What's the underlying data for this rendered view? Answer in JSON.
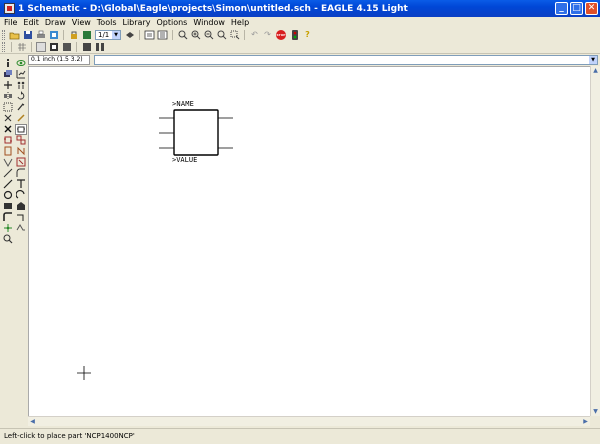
{
  "window": {
    "title": "1 Schematic - D:\\Global\\Eagle\\projects\\Simon\\untitled.sch - EAGLE 4.15 Light",
    "minimize": "_",
    "maximize": "□",
    "close": "✕"
  },
  "menu": {
    "file": "File",
    "edit": "Edit",
    "draw": "Draw",
    "view": "View",
    "tools": "Tools",
    "library": "Library",
    "options": "Options",
    "window": "Window",
    "help": "Help"
  },
  "toolbar": {
    "sheet_select": "1/1",
    "stop_label": "STOP",
    "help_label": "?"
  },
  "command": {
    "grid_readout": "0.1 inch (1.5 3.2)",
    "command_line_value": ""
  },
  "palette": {
    "icons": [
      "info-icon",
      "show-icon",
      "display-icon",
      "mark-icon",
      "move-icon",
      "copy-icon",
      "mirror-icon",
      "rotate-icon",
      "group-icon",
      "change-icon",
      "cut-icon",
      "paste-icon",
      "delete-icon",
      "add-icon",
      "pinswap-icon",
      "gateswap-icon",
      "replace-icon",
      "name-icon",
      "value-icon",
      "smash-icon",
      "split-icon",
      "miter-icon",
      "wire-icon",
      "text-icon",
      "circle-icon",
      "arc-icon",
      "rect-icon",
      "polygon-icon",
      "bus-icon",
      "net-icon",
      "junction-icon",
      "label-icon",
      "erc-icon"
    ]
  },
  "schematic": {
    "name_placeholder": ">NAME",
    "value_placeholder": ">VALUE",
    "part_outline_color": "#000000"
  },
  "status": {
    "message": "Left-click to place part 'NCP1400NCP'"
  }
}
